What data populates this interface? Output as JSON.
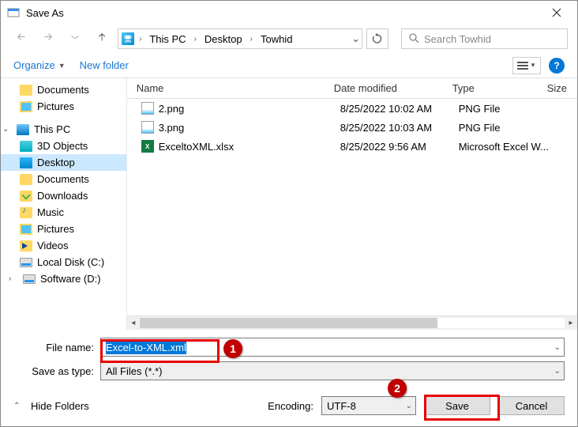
{
  "title": "Save As",
  "breadcrumb": {
    "root": "This PC",
    "p1": "Desktop",
    "p2": "Towhid"
  },
  "search_placeholder": "Search Towhid",
  "toolbar": {
    "organize": "Organize",
    "newfolder": "New folder"
  },
  "sidebar": {
    "documents": "Documents",
    "pictures": "Pictures",
    "thispc": "This PC",
    "objects3d": "3D Objects",
    "desktop": "Desktop",
    "documents2": "Documents",
    "downloads": "Downloads",
    "music": "Music",
    "pictures2": "Pictures",
    "videos": "Videos",
    "localc": "Local Disk (C:)",
    "softwared": "Software (D:)"
  },
  "columns": {
    "name": "Name",
    "date": "Date modified",
    "type": "Type",
    "size": "Size"
  },
  "files": [
    {
      "name": "2.png",
      "date": "8/25/2022 10:02 AM",
      "type": "PNG File",
      "icon": "png"
    },
    {
      "name": "3.png",
      "date": "8/25/2022 10:03 AM",
      "type": "PNG File",
      "icon": "png"
    },
    {
      "name": "ExceltoXML.xlsx",
      "date": "8/25/2022 9:56 AM",
      "type": "Microsoft Excel W...",
      "icon": "xl"
    }
  ],
  "labels": {
    "filename": "File name:",
    "saveas": "Save as type:",
    "encoding": "Encoding:",
    "hide": "Hide Folders"
  },
  "filename_value": "Excel-to-XML.xml",
  "saveas_value": "All Files  (*.*)",
  "encoding_value": "UTF-8",
  "buttons": {
    "save": "Save",
    "cancel": "Cancel"
  },
  "annotations": {
    "badge1": "1",
    "badge2": "2"
  }
}
